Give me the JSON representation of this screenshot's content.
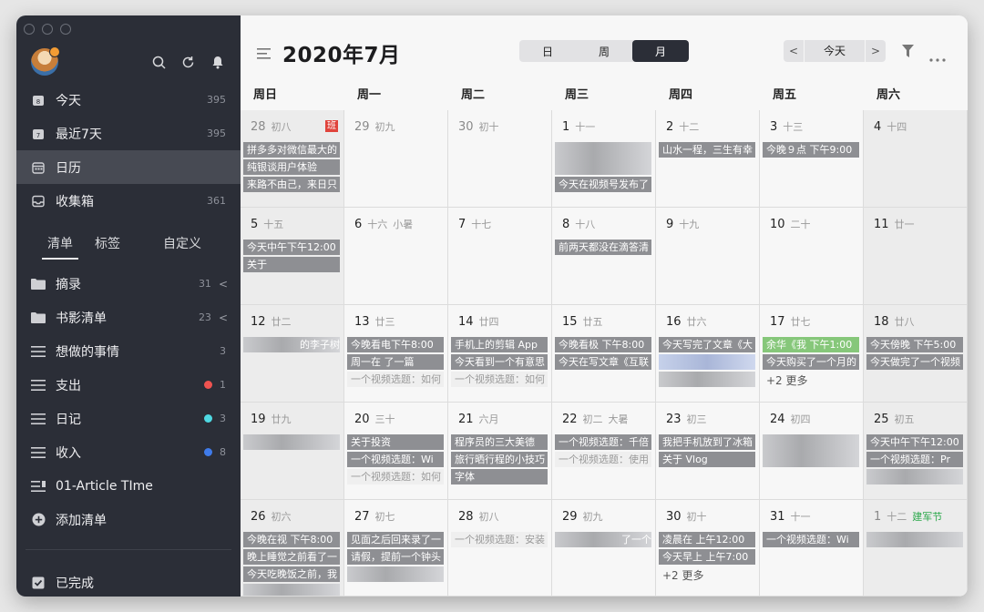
{
  "sidebar": {
    "items": [
      {
        "label": "今天",
        "count": "395"
      },
      {
        "label": "最近7天",
        "count": "395"
      },
      {
        "label": "日历",
        "count": ""
      },
      {
        "label": "收集箱",
        "count": "361"
      }
    ],
    "tabs": [
      "清单",
      "标签",
      "自定义"
    ],
    "lists": [
      {
        "label": "摘录",
        "count": "31"
      },
      {
        "label": "书影清单",
        "count": "23"
      },
      {
        "label": "想做的事情",
        "count": "3"
      },
      {
        "label": "支出",
        "count": "1",
        "dot": "#ef5350"
      },
      {
        "label": "日记",
        "count": "3",
        "dot": "#4fd9e2"
      },
      {
        "label": "收入",
        "count": "8",
        "dot": "#3f7bea"
      },
      {
        "label": "01-Article TIme",
        "count": ""
      }
    ],
    "add_list": "添加清单",
    "completed": "已完成"
  },
  "header": {
    "title": "2020年7月",
    "views": [
      "日",
      "周",
      "月"
    ],
    "active_view": "月",
    "today": "今天"
  },
  "weekdays": [
    "周日",
    "周一",
    "周二",
    "周三",
    "周四",
    "周五",
    "周六"
  ],
  "weeks": [
    [
      {
        "d": "28",
        "l": "初八",
        "dim": true,
        "badge": "班",
        "ev": [
          "拼多多对微信最大的",
          "纯银谈用户体验",
          "来路不由己，来日只"
        ]
      },
      {
        "d": "29",
        "l": "初九",
        "dim": true,
        "ev": []
      },
      {
        "d": "30",
        "l": "初十",
        "dim": true,
        "ev": []
      },
      {
        "d": "1",
        "l": "十一",
        "ev": [
          {
            "blur": true,
            "h": 36
          },
          "今天在视频号发布了"
        ]
      },
      {
        "d": "2",
        "l": "十二",
        "ev": [
          "山水一程，三生有幸"
        ]
      },
      {
        "d": "3",
        "l": "十三",
        "ev": [
          "今晚９点 下午9:00"
        ]
      },
      {
        "d": "4",
        "l": "十四",
        "ev": []
      }
    ],
    [
      {
        "d": "5",
        "l": "十五",
        "ev": [
          "今天中午下午12:00",
          "关于"
        ]
      },
      {
        "d": "6",
        "l": "十六",
        "fest": "小暑",
        "ev": []
      },
      {
        "d": "7",
        "l": "十七",
        "ev": []
      },
      {
        "d": "8",
        "l": "十八",
        "ev": [
          "前两天都没在滴答清"
        ]
      },
      {
        "d": "9",
        "l": "十九",
        "ev": []
      },
      {
        "d": "10",
        "l": "二十",
        "ev": []
      },
      {
        "d": "11",
        "l": "廿一",
        "ev": []
      }
    ],
    [
      {
        "d": "12",
        "l": "廿二",
        "ev": [
          {
            "t": "的李子树",
            "blur": true
          }
        ]
      },
      {
        "d": "13",
        "l": "廿三",
        "ev": [
          "今晚看电下午8:00",
          "周一在 了一篇",
          {
            "t": "一个视频选题：如何",
            "light": true
          }
        ]
      },
      {
        "d": "14",
        "l": "廿四",
        "ev": [
          "手机上的剪辑 App",
          "今天看到一个有意思",
          {
            "t": "一个视频选题：如何",
            "light": true
          }
        ]
      },
      {
        "d": "15",
        "l": "廿五",
        "ev": [
          "今晚看极 下午8:00",
          "今天在写文章《互联"
        ]
      },
      {
        "d": "16",
        "l": "廿六",
        "ev": [
          "今天写完了文章《大",
          {
            "blurblue": true
          },
          {
            "blur": true
          }
        ]
      },
      {
        "d": "17",
        "l": "廿七",
        "more": "+2 更多",
        "ev": [
          {
            "t": "余华《我 下午1:00",
            "green": true
          },
          "今天购买了一个月的"
        ]
      },
      {
        "d": "18",
        "l": "廿八",
        "ev": [
          "今天傍晚 下午5:00",
          "今天做完了一个视频"
        ]
      }
    ],
    [
      {
        "d": "19",
        "l": "廿九",
        "ev": [
          {
            "blur": true
          }
        ]
      },
      {
        "d": "20",
        "l": "三十",
        "ev": [
          "关于投资",
          "一个视频选题：Wi",
          {
            "t": "一个视频选题：如何",
            "light": true
          }
        ]
      },
      {
        "d": "21",
        "l": "六月",
        "ev": [
          "程序员的三大美德",
          "旅行晒行程的小技巧",
          "字体"
        ]
      },
      {
        "d": "22",
        "l": "初二",
        "fest": "大暑",
        "ev": [
          "一个视频选题：千倍",
          {
            "t": "一个视频选题：使用",
            "light": true
          }
        ]
      },
      {
        "d": "23",
        "l": "初三",
        "ev": [
          "我把手机放到了冰箱",
          "关于 Vlog"
        ]
      },
      {
        "d": "24",
        "l": "初四",
        "ev": [
          {
            "blur": true,
            "h": 36
          }
        ]
      },
      {
        "d": "25",
        "l": "初五",
        "ev": [
          "今天中午下午12:00",
          "一个视频选题：Pr",
          {
            "blur": true
          }
        ]
      }
    ],
    [
      {
        "d": "26",
        "l": "初六",
        "ev": [
          "今晚在视 下午8:00",
          "晚上睡觉之前看了一",
          "今天吃晚饭之前，我",
          {
            "blur": true
          }
        ]
      },
      {
        "d": "27",
        "l": "初七",
        "ev": [
          "见面之后回来录了一",
          "请假，提前一个钟头",
          {
            "blur": true
          }
        ]
      },
      {
        "d": "28",
        "l": "初八",
        "ev": [
          {
            "t": "一个视频选题：安装",
            "light": true
          }
        ]
      },
      {
        "d": "29",
        "l": "初九",
        "ev": [
          {
            "t": "了一个",
            "blur": true
          }
        ]
      },
      {
        "d": "30",
        "l": "初十",
        "more": "+2 更多",
        "ev": [
          "凌晨在 上午12:00",
          "今天早上 上午7:00"
        ]
      },
      {
        "d": "31",
        "l": "十一",
        "ev": [
          "一个视频选题：Wi"
        ]
      },
      {
        "d": "1",
        "l": "十二",
        "dim": true,
        "fest": "建军节",
        "ev": [
          {
            "blur": true
          }
        ]
      }
    ]
  ],
  "colors": {
    "sidebar": "#2b2e37",
    "accent": "#2b2e37",
    "event": "#8e8f93",
    "holiday": "#2aa84a"
  }
}
